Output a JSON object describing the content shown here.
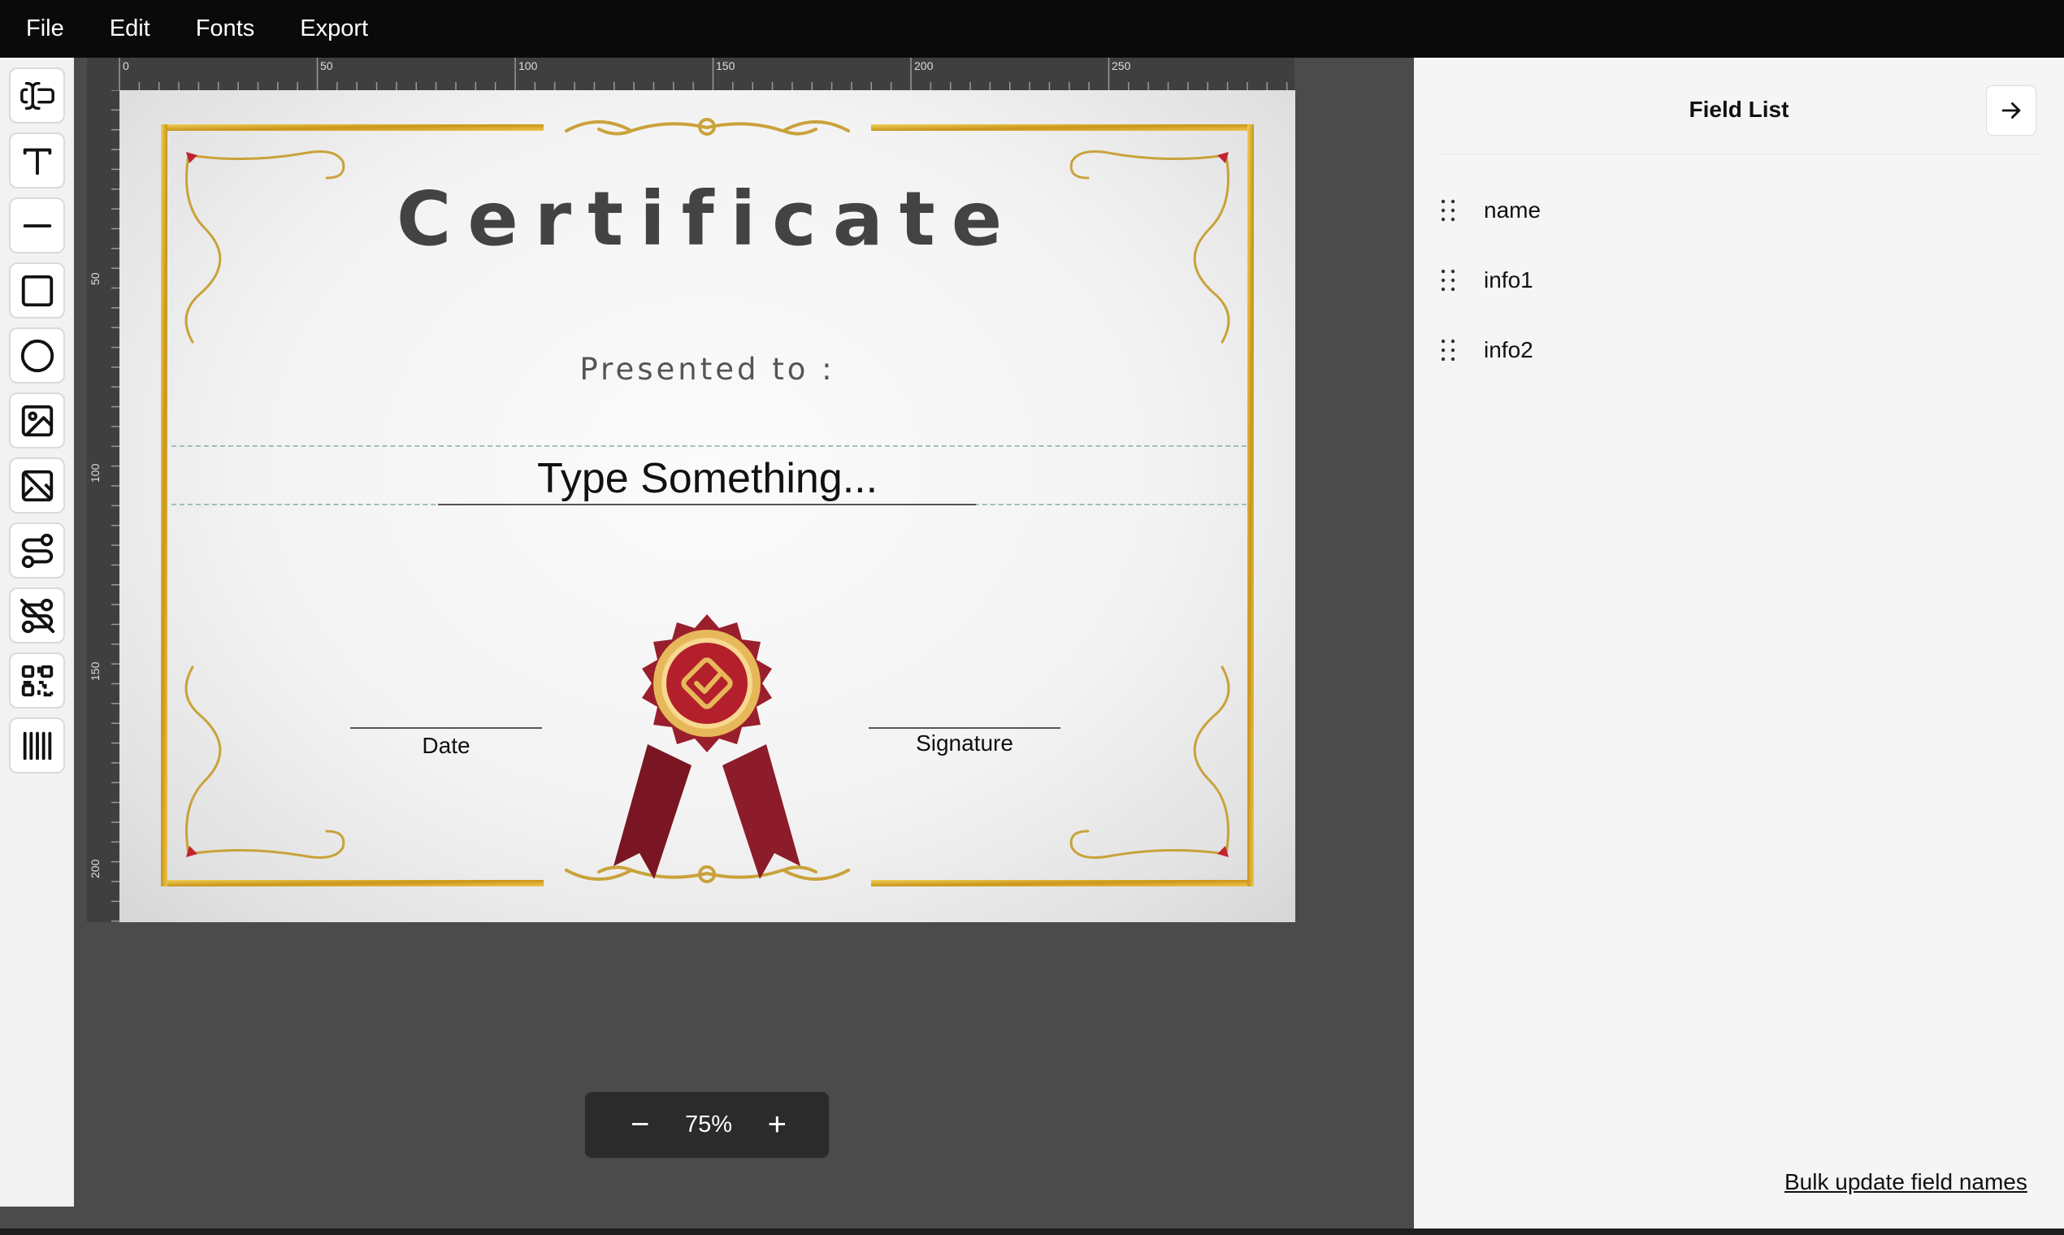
{
  "menu": [
    "File",
    "Edit",
    "Fonts",
    "Export"
  ],
  "toolbar": {
    "tools": [
      {
        "name": "text-field-icon"
      },
      {
        "name": "text-icon"
      },
      {
        "name": "line-icon"
      },
      {
        "name": "rectangle-icon"
      },
      {
        "name": "ellipse-icon"
      },
      {
        "name": "image-icon"
      },
      {
        "name": "svg-icon"
      },
      {
        "name": "route-icon"
      },
      {
        "name": "route-off-icon"
      },
      {
        "name": "qr-code-icon"
      },
      {
        "name": "barcode-icon"
      }
    ]
  },
  "ruler": {
    "top_labels": [
      "0",
      "50",
      "100",
      "150",
      "200",
      "250"
    ],
    "left_labels": [
      "50",
      "100",
      "150",
      "200"
    ]
  },
  "certificate": {
    "title": "Certificate",
    "subtitle": "Presented to :",
    "name_placeholder": "Type Something...",
    "date_label": "Date",
    "signature_label": "Signature",
    "colors": {
      "gold": "#d8a826",
      "ribbon": "#8a1e2a",
      "seal": "#b3202c"
    }
  },
  "zoom": {
    "minus": "−",
    "value": "75%",
    "plus": "+"
  },
  "field_panel": {
    "title": "Field List",
    "fields": [
      "name",
      "info1",
      "info2"
    ],
    "bulk_link": "Bulk update field names"
  }
}
